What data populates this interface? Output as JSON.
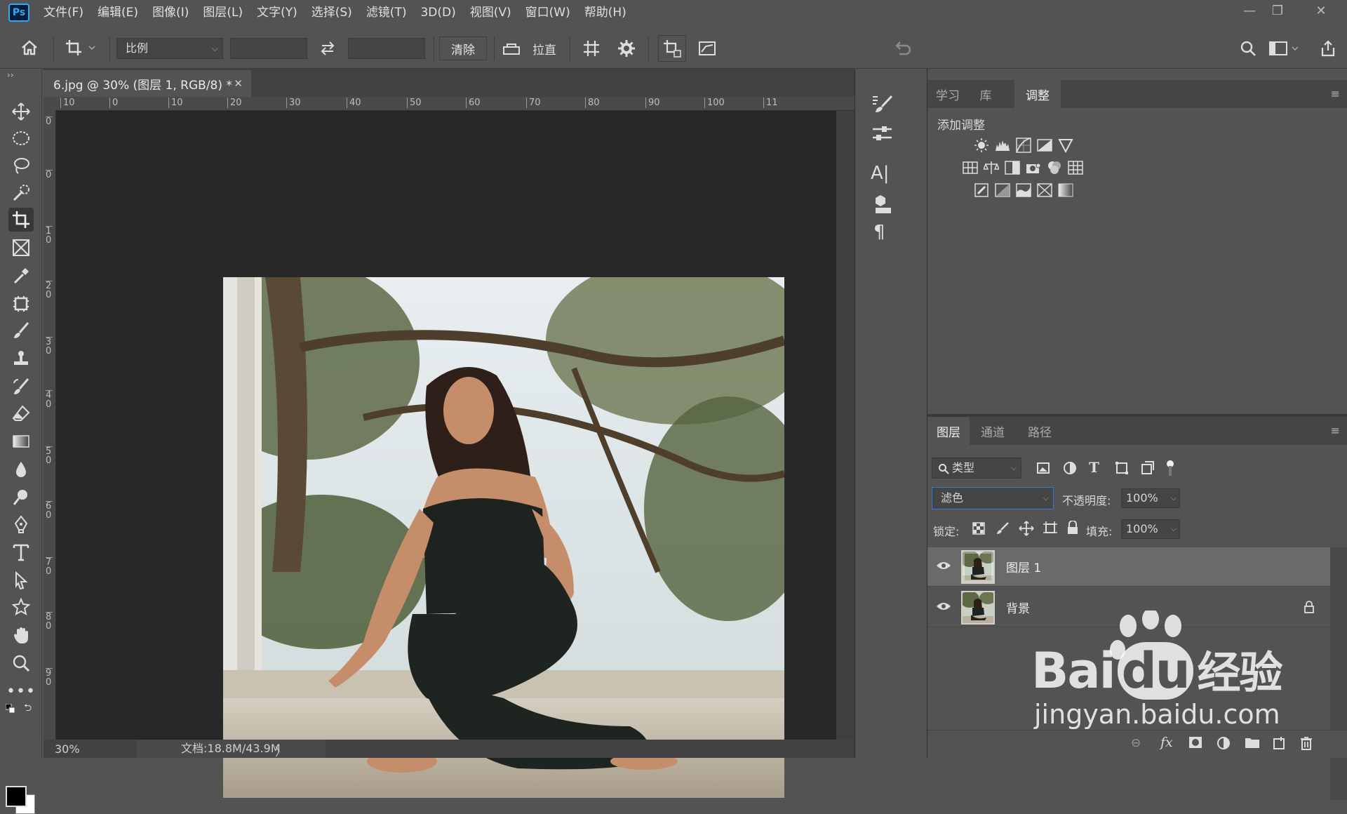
{
  "app": {
    "logo": "Ps"
  },
  "menu": [
    "文件(F)",
    "编辑(E)",
    "图像(I)",
    "图层(L)",
    "文字(Y)",
    "选择(S)",
    "滤镜(T)",
    "3D(D)",
    "视图(V)",
    "窗口(W)",
    "帮助(H)"
  ],
  "window_controls": {
    "minimize": "—",
    "restore": "❐",
    "close": "✕"
  },
  "options": {
    "ratio_select": "比例",
    "clear_button": "清除",
    "straighten_label": "拉直"
  },
  "document": {
    "tab_title": "6.jpg @ 30% (图层 1, RGB/8) *",
    "close": "✕"
  },
  "ruler_h_labels": [
    "10",
    "0",
    "10",
    "20",
    "30",
    "40",
    "50",
    "60",
    "70",
    "80",
    "90",
    "100",
    "11"
  ],
  "ruler_v_labels": [
    "0",
    "0",
    "10",
    "20",
    "30",
    "40",
    "50",
    "60",
    "70",
    "80",
    "90"
  ],
  "status": {
    "zoom": "30%",
    "doc_info": "文档:18.8M/43.9M",
    "arrow": "〉"
  },
  "adjust_panel": {
    "tabs": [
      "学习",
      "库",
      "调整"
    ],
    "selected_tab": "调整",
    "title": "添加调整",
    "icons_row1": [
      "brightness-icon",
      "levels-icon",
      "curves-icon",
      "exposure-icon",
      "vibrance-icon"
    ],
    "icons_row2": [
      "hue-saturation-icon",
      "color-balance-icon",
      "black-white-icon",
      "photo-filter-icon",
      "channel-mixer-icon",
      "color-lookup-icon"
    ],
    "icons_row3": [
      "invert-icon",
      "posterize-icon",
      "threshold-icon",
      "selective-color-icon",
      "gradient-map-icon"
    ]
  },
  "layers_panel": {
    "tabs": [
      "图层",
      "通道",
      "路径"
    ],
    "selected_tab": "图层",
    "filter_kind": "类型",
    "blend_mode": "滤色",
    "opacity_label": "不透明度:",
    "opacity_value": "100%",
    "lock_label": "锁定:",
    "fill_label": "填充:",
    "fill_value": "100%",
    "layers": [
      {
        "name": "图层 1",
        "visible": true,
        "selected": true,
        "locked": false
      },
      {
        "name": "背景",
        "visible": true,
        "selected": false,
        "locked": true
      }
    ]
  },
  "watermark": {
    "brand": "Bai",
    "brand2": "du",
    "cn": "经验",
    "url": "jingyan.baidu.com"
  },
  "colors": {
    "accent": "#31a8ff",
    "panel": "#535353",
    "dark": "#282828"
  }
}
